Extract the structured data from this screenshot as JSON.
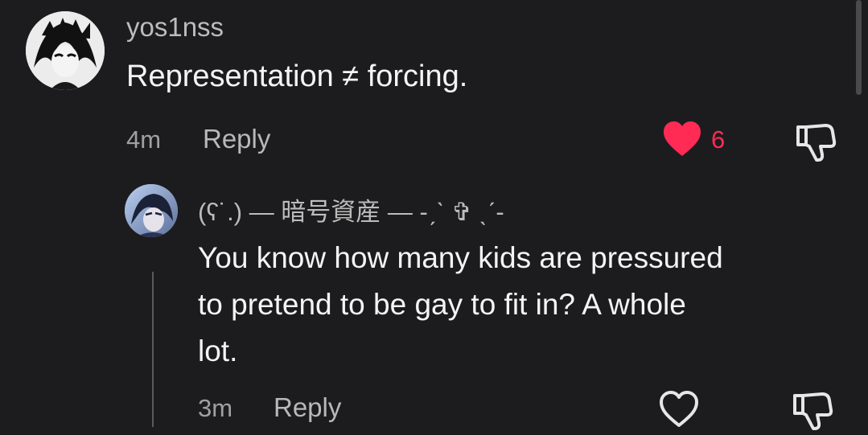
{
  "comments": [
    {
      "username": "yos1nss",
      "text": "Representation ≠ forcing.",
      "time": "4m",
      "reply_label": "Reply",
      "like_count": "6",
      "liked": true
    }
  ],
  "reply": {
    "username": "(ʕ˙.) — 暗号資産 — -ˏˋ ✞ ˎˊ-",
    "text_lines": [
      "You know how many kids are pressured",
      "to pretend to be gay to fit in? A whole",
      "lot."
    ],
    "time": "3m",
    "reply_label": "Reply",
    "liked": false
  },
  "colors": {
    "background": "#1c1c1e",
    "like_active": "#ff2b55",
    "muted_text": "#a0a0a0"
  },
  "icons": {
    "like": "heart-icon",
    "dislike": "thumbs-down-icon"
  }
}
